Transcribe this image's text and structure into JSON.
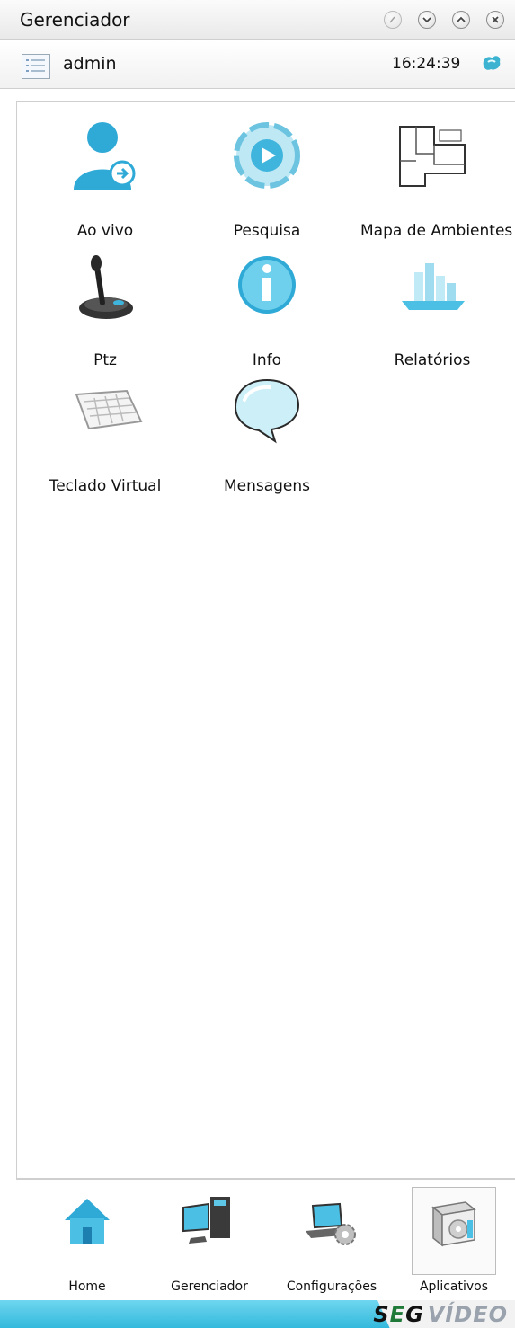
{
  "window": {
    "title": "Gerenciador"
  },
  "user": {
    "name": "admin",
    "time": "16:24:39"
  },
  "apps": [
    {
      "label": "Ao vivo",
      "icon": "live-user-icon"
    },
    {
      "label": "Pesquisa",
      "icon": "search-playback-icon"
    },
    {
      "label": "Mapa de Ambientes",
      "icon": "floor-map-icon"
    },
    {
      "label": "Ptz",
      "icon": "joystick-icon"
    },
    {
      "label": "Info",
      "icon": "info-icon"
    },
    {
      "label": "Relatórios",
      "icon": "reports-icon"
    },
    {
      "label": "Teclado Virtual",
      "icon": "keyboard-icon"
    },
    {
      "label": "Mensagens",
      "icon": "speech-bubble-icon"
    }
  ],
  "dock": [
    {
      "label": "Home",
      "icon": "home-icon"
    },
    {
      "label": "Gerenciador",
      "icon": "monitor-icon"
    },
    {
      "label": "Configurações",
      "icon": "laptop-settings-icon"
    },
    {
      "label": "Aplicativos",
      "icon": "apps-box-icon"
    }
  ],
  "footer": {
    "brand_s": "S",
    "brand_e": "E",
    "brand_g": "G",
    "brand_rest": "VÍDEO"
  },
  "colors": {
    "accent": "#3bbfe0",
    "brand_green": "#1f7a3a",
    "text": "#111111"
  }
}
